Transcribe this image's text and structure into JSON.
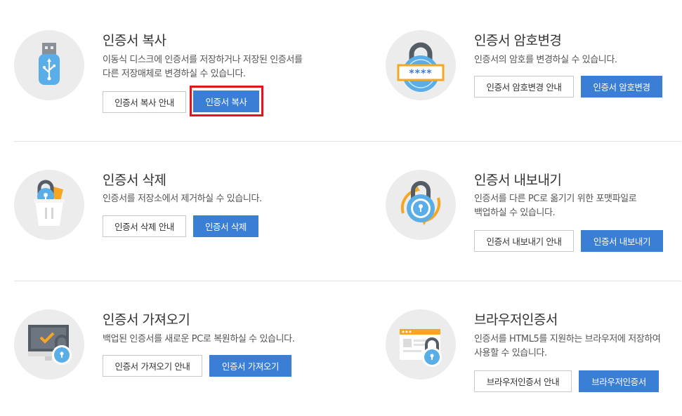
{
  "copy": {
    "title": "인증서 복사",
    "desc_line1": "이동식 디스크에 인증서를 저장하거나 저장된 인증서를",
    "desc_line2": "다른 저장매체로 변경하실 수 있습니다.",
    "guide_label": "인증서 복사 안내",
    "action_label": "인증서 복사",
    "icon": "usb-drive-icon",
    "highlighted": true
  },
  "change_password": {
    "title": "인증서 암호변경",
    "desc_line1": "인증서의 암호를 변경하실 수 있습니다.",
    "guide_label": "인증서 암호변경 안내",
    "action_label": "인증서 암호변경",
    "icon": "password-lock-icon"
  },
  "delete": {
    "title": "인증서 삭제",
    "desc_line1": "인증서를 저장소에서 제거하실 수 있습니다.",
    "guide_label": "인증서 삭제 안내",
    "action_label": "인증서 삭제",
    "icon": "trash-lock-icon"
  },
  "export": {
    "title": "인증서 내보내기",
    "desc_line1": "인증서를 다른 PC로 옮기기 위한 포맷파일로",
    "desc_line2": "백업하실 수 있습니다.",
    "guide_label": "인증서 내보내기 안내",
    "action_label": "인증서 내보내기",
    "icon": "export-lock-icon"
  },
  "import": {
    "title": "인증서 가져오기",
    "desc_line1": "백업된 인증서를 새로운 PC로 복원하실 수 있습니다.",
    "guide_label": "인증서 가져오기 안내",
    "action_label": "인증서 가져오기",
    "icon": "monitor-lock-icon"
  },
  "browser_cert": {
    "title": "브라우저인증서",
    "desc_line1": "인증서를 HTML5를 지원하는 브라우저에 저장하여",
    "desc_line2": "사용할 수 있습니다.",
    "guide_label": "브라우저인증서 안내",
    "action_label": "브라우저인증서",
    "icon": "browser-lock-icon"
  },
  "colors": {
    "primary": "#3a7ed6",
    "highlight": "#e4121a",
    "lock_blue": "#5aaee8",
    "lock_gray": "#545c66",
    "accent_orange": "#f5a623"
  }
}
